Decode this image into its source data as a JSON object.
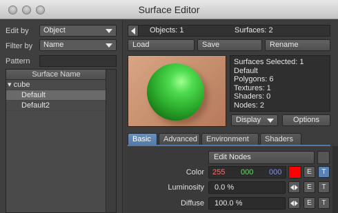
{
  "window": {
    "title": "Surface Editor"
  },
  "left_panel": {
    "edit_by": {
      "label": "Edit by",
      "value": "Object"
    },
    "filter_by": {
      "label": "Filter by",
      "value": "Name"
    },
    "pattern": {
      "label": "Pattern",
      "value": ""
    },
    "tree": {
      "header": "Surface Name",
      "group": {
        "toggle": "▾",
        "name": "cube"
      },
      "items": [
        "Default",
        "Default2"
      ]
    }
  },
  "top_bar": {
    "objects": "Objects: 1",
    "surfaces": "Surfaces: 2"
  },
  "buttons": {
    "load": "Load",
    "save": "Save",
    "rename": "Rename",
    "display": "Display",
    "options": "Options"
  },
  "info": {
    "lines": [
      "Surfaces Selected: 1",
      "Default",
      "Polygons: 6",
      "Textures: 1",
      "Shaders: 0",
      "Nodes: 2"
    ]
  },
  "tabs": [
    "Basic",
    "Advanced",
    "Environment",
    "Shaders"
  ],
  "basic": {
    "edit_nodes": "Edit Nodes",
    "color": {
      "label": "Color",
      "r": "255",
      "g": "000",
      "b": "000",
      "swatch": "#ff0000"
    },
    "luminosity": {
      "label": "Luminosity",
      "value": "0.0 %"
    },
    "diffuse": {
      "label": "Diffuse",
      "value": "100.0 %"
    },
    "envelope_label": "E",
    "texture_label": "T"
  },
  "colors": {
    "accent": "#5479a6",
    "red_channel": "#ff6f6f",
    "green_channel": "#6fdc6f",
    "blue_channel": "#7f8fff"
  }
}
